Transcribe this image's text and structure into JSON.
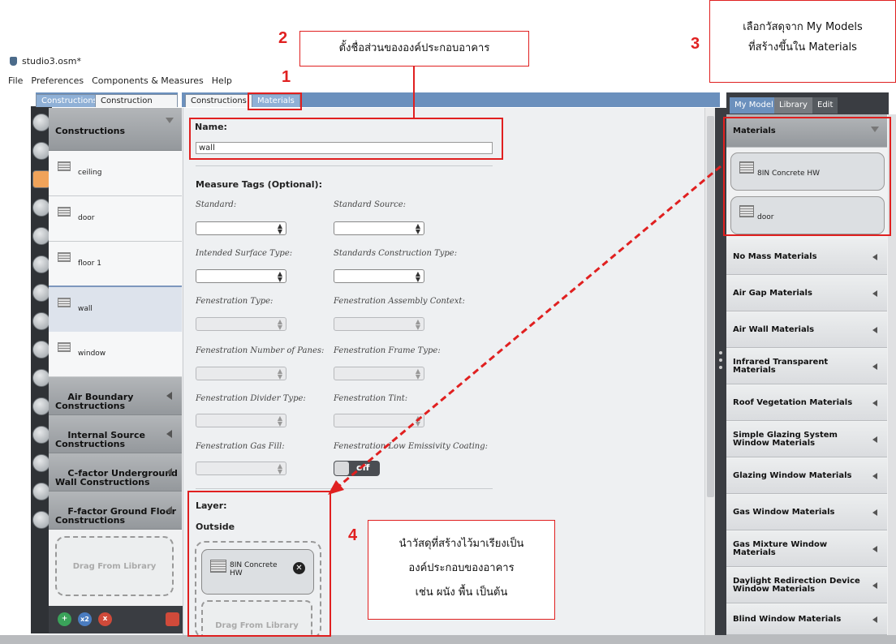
{
  "window": {
    "title": "studio3.osm*"
  },
  "menu": [
    "File",
    "Preferences",
    "Components & Measures",
    "Help"
  ],
  "left_tabs": [
    "Constructions",
    "Construction Sets"
  ],
  "mid_tabs": [
    "Constructions",
    "Materials"
  ],
  "left_list": {
    "header": "Constructions",
    "items": [
      "ceiling",
      "door",
      "floor 1",
      "wall",
      "window"
    ],
    "selected": "wall",
    "categories": [
      "Air Boundary\nConstructions",
      "Internal Source\nConstructions",
      "C-factor Underground\nWall Constructions",
      "F-factor Ground Floor\nConstructions"
    ],
    "drag_label": "Drag From Library",
    "bottom_buttons": [
      "+",
      "x2",
      "x",
      "trash"
    ]
  },
  "form": {
    "name_label": "Name:",
    "name_value": "wall",
    "measure_tags_label": "Measure Tags (Optional):",
    "fields": [
      "Standard:",
      "Standard Source:",
      "Intended Surface Type:",
      "Standards Construction Type:",
      "Fenestration Type:",
      "Fenestration Assembly Context:",
      "Fenestration Number of Panes:",
      "Fenestration Frame Type:",
      "Fenestration Divider Type:",
      "Fenestration Tint:",
      "Fenestration Gas Fill:",
      "Fenestration Low Emissivity Coating:"
    ],
    "low_e_toggle": "off",
    "layer_label": "Layer:",
    "outside_label": "Outside",
    "layer_material": "8IN Concrete\nHW",
    "drag_label": "Drag From Library"
  },
  "right_tabs": [
    "My Model",
    "Library",
    "Edit"
  ],
  "right_panel": {
    "header": "Materials",
    "materials": [
      "8IN Concrete HW",
      "door"
    ],
    "categories": [
      "No Mass Materials",
      "Air Gap Materials",
      "Air Wall Materials",
      "Infrared Transparent\nMaterials",
      "Roof Vegetation Materials",
      "Simple Glazing System\nWindow Materials",
      "Glazing Window Materials",
      "Gas Window Materials",
      "Gas Mixture Window\nMaterials",
      "Daylight Redirection Device\nWindow Materials",
      "Blind Window Materials"
    ]
  },
  "annotations": {
    "n1": "1",
    "n2": "2",
    "n3": "3",
    "n4": "4",
    "note2": "ตั้งชื่อส่วนขององค์ประกอบอาคาร",
    "note3_l1": "เลือกวัสดุจาก My Models",
    "note3_l2": "ที่สร้างขึ้นใน Materials",
    "note4_l1": "นำวัสดุที่สร้างไว้มาเรียงเป็น",
    "note4_l2": "องค์ประกอบของอาคาร",
    "note4_l3": "เช่น ผนัง พื้น เป็นต้น",
    "color": "#e02020"
  }
}
